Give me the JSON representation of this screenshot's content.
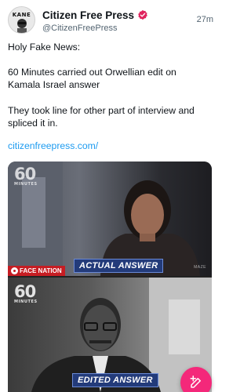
{
  "post": {
    "author": {
      "display_name": "Citizen Free Press",
      "handle": "@CitizenFreePress",
      "avatar_text": "KANE",
      "verified": true
    },
    "timestamp": "27m",
    "text_lines": [
      "Holy Fake News:",
      "60 Minutes carried out Orwellian edit on",
      "Kamala Israel answer",
      "They took line for other part of interview and",
      "spliced it in."
    ],
    "link": "citizenfreepress.com/",
    "media": {
      "top": {
        "logo_number": "60",
        "logo_word": "MINUTES",
        "caption": "ACTUAL ANSWER",
        "banner": "FACE NATION",
        "corner_text": "MAZE"
      },
      "bottom": {
        "logo_number": "60",
        "logo_word": "MINUTES",
        "caption": "EDITED ANSWER"
      }
    }
  },
  "colors": {
    "verified_badge": "#e0245e",
    "link": "#1d9bf0",
    "compose_button": "#f4287a",
    "caption_bg": "#233b7a",
    "banner_bg": "#c61d23"
  },
  "icons": {
    "verified": "verified-badge-icon",
    "compose": "compose-icon"
  }
}
